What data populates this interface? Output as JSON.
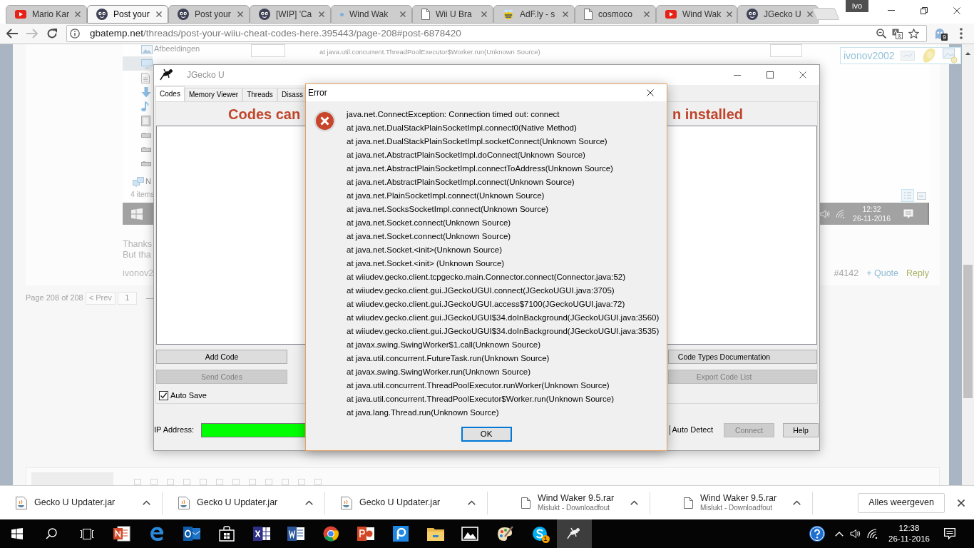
{
  "browser": {
    "tabs": [
      {
        "title": "Mario Kar",
        "kind": "video",
        "selected": false
      },
      {
        "title": "Post your",
        "kind": "mascot",
        "selected": true
      },
      {
        "title": "Post your",
        "kind": "mascot",
        "selected": false
      },
      {
        "title": "[WIP] 'Ca",
        "kind": "mascot",
        "selected": false
      },
      {
        "title": "Wind Wak",
        "kind": "dot",
        "selected": false
      },
      {
        "title": "Wii U Bra",
        "kind": "page",
        "selected": false
      },
      {
        "title": "AdF.ly - s",
        "kind": "bee",
        "selected": false
      },
      {
        "title": "cosmoco",
        "kind": "page",
        "selected": false
      },
      {
        "title": "Wind Wak",
        "kind": "video",
        "selected": false
      },
      {
        "title": "JGecko U",
        "kind": "mascot",
        "selected": false
      }
    ],
    "profile": "ivo",
    "address": {
      "host": "gbatemp.net",
      "path": "/threads/post-your-wiiu-cheat-codes-here.395443/page-208#post-6878420"
    },
    "extension_badge": "9"
  },
  "page": {
    "post_image": {
      "nav_items": [
        {
          "kind": "pictures",
          "label": "Afbeeldingen",
          "selected": false
        },
        {
          "kind": "desktop",
          "selected": true
        },
        {
          "kind": "document",
          "selected": false
        },
        {
          "kind": "download",
          "selected": false
        },
        {
          "kind": "music",
          "selected": false
        },
        {
          "kind": "video",
          "selected": false
        },
        {
          "kind": "drive",
          "selected": false
        },
        {
          "kind": "drive",
          "selected": false
        },
        {
          "kind": "drive",
          "selected": false
        },
        {
          "kind": "network",
          "label": "N",
          "selected": false
        }
      ],
      "item_count": "4 items",
      "trace_line": "at java.util.concurrent.ThreadPoolExecutor$Worker.run(Unknown Source)",
      "username": "ivonov2002",
      "clock": {
        "time": "12:32",
        "date": "26-11-2016"
      }
    },
    "post_lines": [
      "Thanks",
      "But tha"
    ],
    "author": "ivonov2",
    "post_links": [
      "#4142",
      "+ Quote",
      "Reply"
    ],
    "pagination": {
      "label": "Page 208 of 208",
      "prev": "< Prev",
      "pages": [
        "1"
      ],
      "gap": "—"
    }
  },
  "jgecko": {
    "title": "JGecko U",
    "tabs": [
      {
        "label": "Codes",
        "selected": true
      },
      {
        "label": "Memory Viewer",
        "selected": false
      },
      {
        "label": "Threads",
        "selected": false
      },
      {
        "label": "Disass",
        "selected": false
      }
    ],
    "banner": [
      "Codes can",
      "n installed"
    ],
    "button_rows": [
      [
        {
          "label": "Add Code",
          "disabled": false
        },
        {
          "label": "Code Types Documentation",
          "disabled": false
        }
      ],
      [
        {
          "label": "Send Codes",
          "disabled": true
        },
        {
          "label": "Export Code List",
          "disabled": true
        }
      ]
    ],
    "auto_save": {
      "label": "Auto Save",
      "checked": true
    },
    "ip_label": "IP Address:",
    "auto_detect": "Auto Detect",
    "connect": {
      "label": "Connect",
      "disabled": true
    },
    "help": {
      "label": "Help",
      "disabled": false
    }
  },
  "error_dialog": {
    "title": "Error",
    "lines": [
      "java.net.ConnectException: Connection timed out: connect",
      "at java.net.DualStackPlainSocketImpl.connect0(Native Method)",
      "at java.net.DualStackPlainSocketImpl.socketConnect(Unknown Source)",
      "at java.net.AbstractPlainSocketImpl.doConnect(Unknown Source)",
      "at java.net.AbstractPlainSocketImpl.connectToAddress(Unknown Source)",
      "at java.net.AbstractPlainSocketImpl.connect(Unknown Source)",
      "at java.net.PlainSocketImpl.connect(Unknown Source)",
      "at java.net.SocksSocketImpl.connect(Unknown Source)",
      "at java.net.Socket.connect(Unknown Source)",
      "at java.net.Socket.connect(Unknown Source)",
      "at java.net.Socket.<init>(Unknown Source)",
      "at java.net.Socket.<init> (Unknown Source)",
      "at wiiudev.gecko.client.tcpgecko.main.Connector.connect(Connector.java:52)",
      "at wiiudev.gecko.client.gui.JGeckoUGUI.connect(JGeckoUGUI.java:3705)",
      "at wiiudev.gecko.client.gui.JGeckoUGUI.access$7100(JGeckoUGUI.java:72)",
      "at wiiudev.gecko.client.gui.JGeckoUGUI$34.doInBackground(JGeckoUGUI.java:3560)",
      "at wiiudev.gecko.client.gui.JGeckoUGUI$34.doInBackground(JGeckoUGUI.java:3535)",
      "at javax.swing.SwingWorker$1.call(Unknown Source)",
      "at java.util.concurrent.FutureTask.run(Unknown Source)",
      "at javax.swing.SwingWorker.run(Unknown Source)",
      "at java.util.concurrent.ThreadPoolExecutor.runWorker(Unknown Source)",
      "at java.util.concurrent.ThreadPoolExecutor$Worker.run(Unknown Source)",
      "at java.lang.Thread.run(Unknown Source)"
    ],
    "button": {
      "label": "OK",
      "focused": true
    }
  },
  "downloads": {
    "items": [
      {
        "name": "Gecko U Updater.jar",
        "kind": "jar"
      },
      {
        "name": "Gecko U Updater.jar",
        "kind": "jar"
      },
      {
        "name": "Gecko U Updater.jar",
        "kind": "jar"
      },
      {
        "name": "Wind Waker 9.5.rar",
        "kind": "file",
        "status": "Mislukt - Downloadfout"
      },
      {
        "name": "Wind Waker 9.5.rar",
        "kind": "file",
        "status": "Mislukt - Downloadfout"
      }
    ],
    "show_all": "Alles weergeven"
  },
  "taskbar": {
    "apps": [
      {
        "kind": "notes",
        "active": false
      },
      {
        "kind": "edge",
        "active": false
      },
      {
        "kind": "mail",
        "active": false
      },
      {
        "kind": "store",
        "active": false
      },
      {
        "kind": "sheets",
        "active": false
      },
      {
        "kind": "word",
        "active": false
      },
      {
        "kind": "chrome",
        "active": false
      },
      {
        "kind": "slides",
        "active": false
      },
      {
        "kind": "tile",
        "active": false
      },
      {
        "kind": "folder",
        "active": false
      },
      {
        "kind": "photos",
        "active": false
      },
      {
        "kind": "palette",
        "active": false
      },
      {
        "kind": "skype",
        "active": false,
        "badge": "1"
      },
      {
        "kind": "gecko",
        "active": true
      }
    ],
    "time": "12:38",
    "date": "26-11-2016"
  }
}
